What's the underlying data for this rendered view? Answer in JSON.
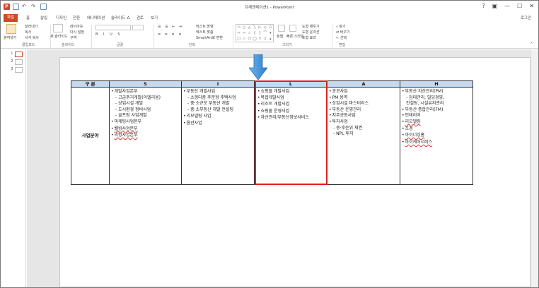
{
  "window": {
    "title": "프레젠테이션1 - PowerPoint",
    "login": "로그인"
  },
  "tabs": [
    "파일",
    "홈",
    "삽입",
    "디자인",
    "전환",
    "애니메이션",
    "슬라이드 쇼",
    "검토",
    "보기"
  ],
  "ribbon": {
    "clipboard": {
      "paste": "붙여넣기",
      "cut": "잘라내기",
      "copy": "복사",
      "format": "서식 복사",
      "label": "클립보드"
    },
    "slides": {
      "new": "새 슬라이드",
      "layout": "레이아웃",
      "reset": "다시 설정",
      "section": "구역",
      "label": "슬라이드"
    },
    "font": {
      "label": "글꼴"
    },
    "paragraph": {
      "label": "단락",
      "dir": "텍스트 방향",
      "align": "텍스트 맞춤",
      "smartart": "SmartArt로 변환"
    },
    "drawing": {
      "label": "그리기",
      "arrange": "정렬",
      "quick": "빠른 스타일",
      "fill": "도형 채우기",
      "outline": "도형 윤곽선",
      "effect": "도형 효과"
    },
    "editing": {
      "label": "편집",
      "find": "찾기",
      "replace": "바꾸기",
      "select": "선택"
    }
  },
  "slides_pane": [
    "1",
    "2",
    "3"
  ],
  "table": {
    "headers": [
      "구 분",
      "S",
      "I",
      "L",
      "A",
      "H"
    ],
    "row_label": "사업분야",
    "S": [
      {
        "t": "개발사업본부",
        "b": true
      },
      {
        "t": "- 고급주거개발(아델리움)",
        "s": true
      },
      {
        "t": "- 상업시설 개발",
        "s": true
      },
      {
        "t": "- 도시환경 정비사업",
        "s": true
      },
      {
        "t": "- 골프장 사업개발",
        "s": true
      },
      {
        "t": "마케팅사업본부",
        "b": true
      },
      {
        "t": "웰빙사업본부",
        "b": true,
        "u": true,
        "g": true
      },
      {
        "t": "리빙사업본부",
        "b": true,
        "u": true,
        "g": true
      }
    ],
    "I": [
      {
        "t": "부동산 개발사업",
        "b": true
      },
      {
        "t": "- 소형다중 주문형 주택사업",
        "s": true
      },
      {
        "t": "- 중·소규모 부동산 개발",
        "s": true
      },
      {
        "t": "- 중·소부동산 개발 컨설팅",
        "s": true
      },
      {
        "t": "리모델링 사업",
        "b": true,
        "g": true
      },
      {
        "t": "옵션사업",
        "b": true,
        "g": true
      }
    ],
    "L": [
      {
        "t": "쇼핑몰 개발사업",
        "b": true
      },
      {
        "t": "복합개발사업",
        "b": true
      },
      {
        "t": "리조트 개발사업",
        "b": true,
        "g": true
      },
      {
        "t": "쇼핑몰 운영사업",
        "b": true,
        "g": true
      },
      {
        "t": "자산관리/부동산정보서비스",
        "b": true,
        "g": true
      }
    ],
    "A": [
      {
        "t": "공모사업",
        "b": true
      },
      {
        "t": "PM 용역",
        "b": true
      },
      {
        "t": "상업시설 마스터리스",
        "b": true
      },
      {
        "t": "부동산 운영관리",
        "b": true
      },
      {
        "t": "지주공동사업",
        "b": true
      },
      {
        "t": "투자사업",
        "b": true
      },
      {
        "t": "- 중·후순위 채권",
        "s": true
      },
      {
        "t": "- NPL 투자",
        "s": true
      }
    ],
    "H": [
      {
        "t": "부동산 자산관리(PM)",
        "b": true
      },
      {
        "t": "- 임대관리, 빌딩경영,",
        "s": true
      },
      {
        "t": "컨설팅, 시설유지관리",
        "s": true
      },
      {
        "t": "부동산 종합관리(FM)",
        "b": true
      },
      {
        "t": "인테리어",
        "b": true
      },
      {
        "t": "리모델링",
        "b": true,
        "u": true
      },
      {
        "t": "조경",
        "b": true,
        "g": true
      },
      {
        "t": "아이너싱홈",
        "b": true,
        "u": true,
        "g": true
      },
      {
        "t": "아이케어서비스",
        "b": true,
        "u": true,
        "g": true
      }
    ]
  },
  "colors": {
    "accent": "#d24726",
    "header": "#c5d9f1",
    "highlight": "#e02020",
    "arrow": "#3d8fd8"
  }
}
